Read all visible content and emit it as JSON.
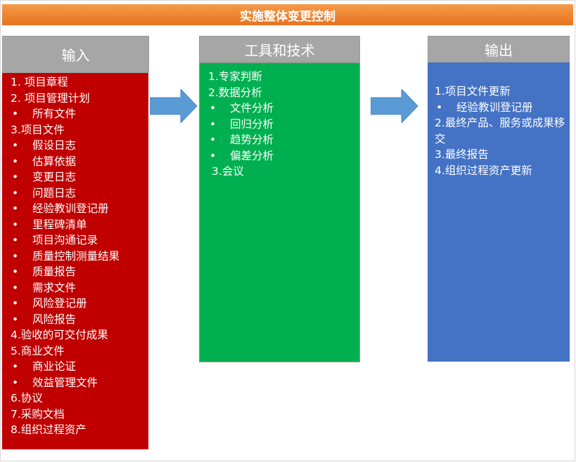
{
  "title": "实施整体变更控制",
  "bullet_glyph": "•",
  "colors": {
    "title_bar": "#ed7d31",
    "header": "#a6a6a6",
    "input_body": "#c00000",
    "tools_body": "#00b050",
    "output_body": "#4472c4",
    "arrow": "#5b9bd5"
  },
  "columns": {
    "input": {
      "header": "输入",
      "items": [
        {
          "type": "number",
          "text": "1. 项目章程"
        },
        {
          "type": "number",
          "text": "2. 项目管理计划"
        },
        {
          "type": "bullet",
          "text": "所有文件"
        },
        {
          "type": "number",
          "text": "3.项目文件"
        },
        {
          "type": "bullet",
          "text": "假设日志"
        },
        {
          "type": "bullet",
          "text": "估算依据"
        },
        {
          "type": "bullet",
          "text": "变更日志"
        },
        {
          "type": "bullet",
          "text": "问题日志"
        },
        {
          "type": "bullet",
          "text": "经验教训登记册"
        },
        {
          "type": "bullet",
          "text": "里程碑清单"
        },
        {
          "type": "bullet",
          "text": "项目沟通记录"
        },
        {
          "type": "bullet",
          "text": "质量控制测量结果"
        },
        {
          "type": "bullet",
          "text": "质量报告"
        },
        {
          "type": "bullet",
          "text": "需求文件"
        },
        {
          "type": "bullet",
          "text": "风险登记册"
        },
        {
          "type": "bullet",
          "text": "风险报告"
        },
        {
          "type": "number",
          "text": "4.验收的可交付成果"
        },
        {
          "type": "number",
          "text": "5.商业文件"
        },
        {
          "type": "bullet",
          "text": "商业论证"
        },
        {
          "type": "bullet",
          "text": "效益管理文件"
        },
        {
          "type": "number",
          "text": "6.协议"
        },
        {
          "type": "number",
          "text": "7.采购文档"
        },
        {
          "type": "number",
          "text": "8.组织过程资产"
        }
      ]
    },
    "tools": {
      "header": "工具和技术",
      "items": [
        {
          "type": "number",
          "text": "1.专家判断"
        },
        {
          "type": "number",
          "text": "2.数据分析"
        },
        {
          "type": "bullet",
          "text": "文件分析"
        },
        {
          "type": "bullet",
          "text": "回归分析"
        },
        {
          "type": "bullet",
          "text": "趋势分析"
        },
        {
          "type": "bullet",
          "text": "偏差分析"
        },
        {
          "type": "number-indent",
          "text": "3.会议"
        }
      ]
    },
    "output": {
      "header": "输出",
      "items": [
        {
          "type": "number",
          "text": "1.项目文件更新"
        },
        {
          "type": "bullet",
          "text": "经验教训登记册"
        },
        {
          "type": "number-wrap",
          "text": "2.最终产品、服务或成果移交"
        },
        {
          "type": "number",
          "text": "3.最终报告"
        },
        {
          "type": "number",
          "text": "4.组织过程资产更新"
        }
      ]
    }
  }
}
